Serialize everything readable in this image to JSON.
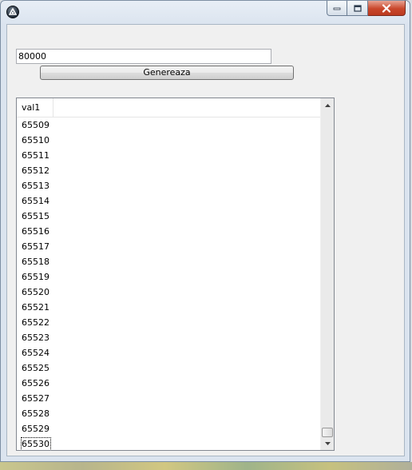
{
  "window": {
    "title": ""
  },
  "input": {
    "value": "80000"
  },
  "button": {
    "label": "Genereaza"
  },
  "list": {
    "column": "val1",
    "rows": [
      "65509",
      "65510",
      "65511",
      "65512",
      "65513",
      "65514",
      "65515",
      "65516",
      "65517",
      "65518",
      "65519",
      "65520",
      "65521",
      "65522",
      "65523",
      "65524",
      "65525",
      "65526",
      "65527",
      "65528",
      "65529",
      "65530"
    ]
  },
  "icons": {
    "app": "app-logo-icon",
    "minimize": "minimize-icon",
    "maximize": "maximize-icon",
    "close": "close-icon",
    "scroll_up": "scroll-up-arrow-icon",
    "scroll_down": "scroll-down-arrow-icon"
  },
  "scroll": {
    "position_fraction": 1.0
  }
}
